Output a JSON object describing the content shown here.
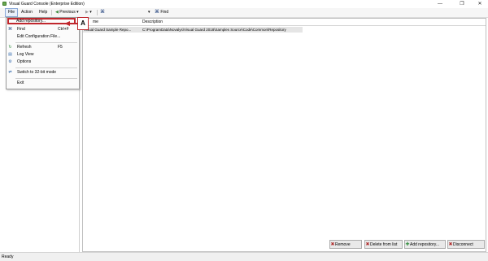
{
  "window": {
    "title": "Visual Guard Console (Enterprise Edition)",
    "minimize": "—",
    "restore": "❐",
    "close": "✕"
  },
  "menubar": {
    "items": [
      "File",
      "Action",
      "Help"
    ]
  },
  "toolbar": {
    "previous": "Previous",
    "find": "Find",
    "dropdown_arrow": "▾"
  },
  "file_menu": {
    "items": [
      {
        "label": "Add repository...",
        "shortcut": "",
        "icon": "add-repository-icon"
      },
      {
        "label": "Find",
        "shortcut": "Ctrl+F",
        "icon": "binoculars-icon"
      },
      {
        "label": "Edit Configuration File...",
        "shortcut": "",
        "icon": ""
      },
      {
        "label": "Refresh",
        "shortcut": "F5",
        "icon": "refresh-icon"
      },
      {
        "label": "Log View",
        "shortcut": "",
        "icon": "log-view-icon"
      },
      {
        "label": "Options",
        "shortcut": "",
        "icon": "options-icon"
      },
      {
        "label": "Switch to 32-bit mode",
        "shortcut": "",
        "icon": "switch-mode-icon"
      },
      {
        "label": "Exit",
        "shortcut": "",
        "icon": ""
      }
    ]
  },
  "callout": {
    "label": "A",
    "color": "#c0272d"
  },
  "grid": {
    "columns": [
      "me",
      "Description"
    ],
    "rows": [
      {
        "name": "Visual Guard Sample Repo...",
        "description": "C:\\ProgramData\\Novalys\\Visual Guard 2018\\Samples Source\\Code\\Common\\Repository"
      }
    ]
  },
  "bottom_buttons": {
    "remove": "Remove",
    "delete_from_list": "Delete from list",
    "add_repository": "Add repository...",
    "disconnect": "Disconnect"
  },
  "status": {
    "text": "Ready"
  }
}
